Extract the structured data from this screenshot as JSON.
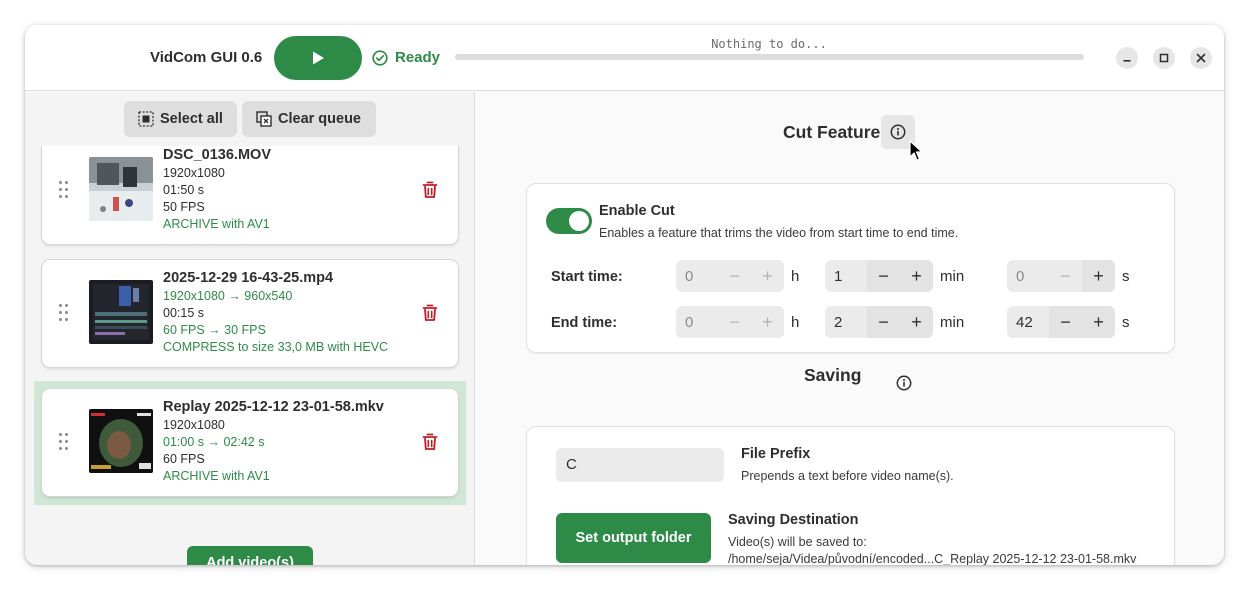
{
  "header": {
    "app_title": "VidCom GUI 0.6",
    "status": "Ready",
    "progress_text": "Nothing to do...",
    "progress_fraction": 0
  },
  "queue_toolbar": {
    "select_all": "Select all",
    "clear_queue": "Clear queue"
  },
  "queue": [
    {
      "name": "DSC_0136.MOV",
      "resolution": "1920x1080",
      "duration": "01:50 s",
      "fps": "50 FPS",
      "action": "ARCHIVE with AV1"
    },
    {
      "name": "2025-12-29 16-43-25.mp4",
      "resolution": "1920x1080 → 960x540",
      "duration": "00:15 s",
      "fps": "60 FPS → 30 FPS",
      "action": "COMPRESS to size 33,0 MB with HEVC"
    },
    {
      "name": "Replay 2025-12-12 23-01-58.mkv",
      "resolution": "1920x1080",
      "duration": "01:00 s → 02:42 s",
      "fps": "60 FPS",
      "action": "ARCHIVE with AV1"
    }
  ],
  "add_videos": "Add video(s)",
  "cut": {
    "title": "Cut Feature",
    "enable_label": "Enable Cut",
    "enable_desc": "Enables a feature that trims the video from start time to end time.",
    "enabled": true,
    "start_label": "Start time:",
    "end_label": "End time:",
    "start": {
      "h": "0",
      "min": "1",
      "s": "0"
    },
    "end": {
      "h": "0",
      "min": "2",
      "s": "42"
    },
    "units": {
      "h": "h",
      "min": "min",
      "s": "s"
    }
  },
  "saving": {
    "title": "Saving",
    "prefix_value": "C",
    "prefix_label": "File Prefix",
    "prefix_desc": "Prepends a text before video name(s).",
    "output_button": "Set output folder",
    "dest_label": "Saving Destination",
    "dest_desc": "Video(s) will be saved to:",
    "dest_path": "/home/seja/Videa/původní/encoded...C_Replay 2025-12-12 23-01-58.mkv"
  },
  "colors": {
    "accent": "#2e8b47",
    "destructive": "#c01c28",
    "selected_row": "#cfe7d4"
  }
}
